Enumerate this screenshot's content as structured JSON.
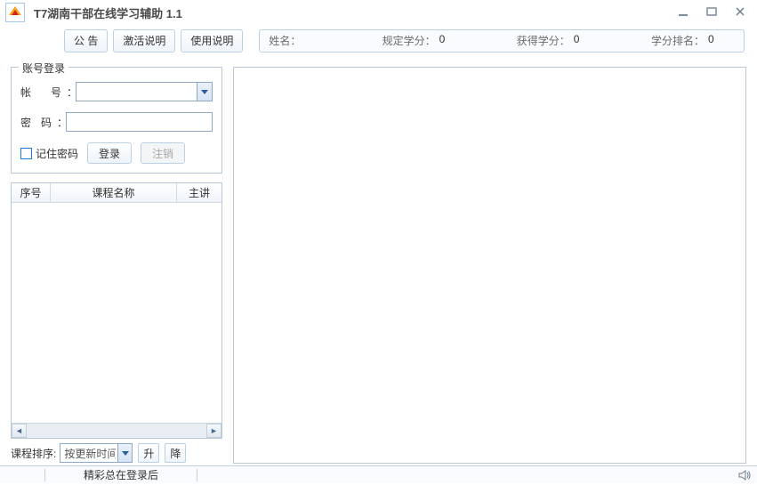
{
  "title": "T7湖南干部在线学习辅助 1.1",
  "toolbar": {
    "announce": "公 告",
    "activate": "激活说明",
    "usage": "使用说明"
  },
  "info": {
    "name_label": "姓名：",
    "name": "",
    "req_label": "规定学分：",
    "req": "0",
    "got_label": "获得学分：",
    "got": "0",
    "rank_label": "学分排名：",
    "rank": "0"
  },
  "login": {
    "legend": "账号登录",
    "account_label": "帐 号",
    "password_label": "密 码",
    "account_value": "",
    "password_value": "",
    "remember": "记住密码",
    "login_btn": "登录",
    "logout_btn": "注销"
  },
  "table": {
    "col_idx": "序号",
    "col_name": "课程名称",
    "col_teacher": "主讲",
    "rows": []
  },
  "sort": {
    "label": "课程排序:",
    "selected": "按更新时间",
    "asc": "升",
    "desc": "降"
  },
  "status": {
    "message": "精彩总在登录后"
  }
}
